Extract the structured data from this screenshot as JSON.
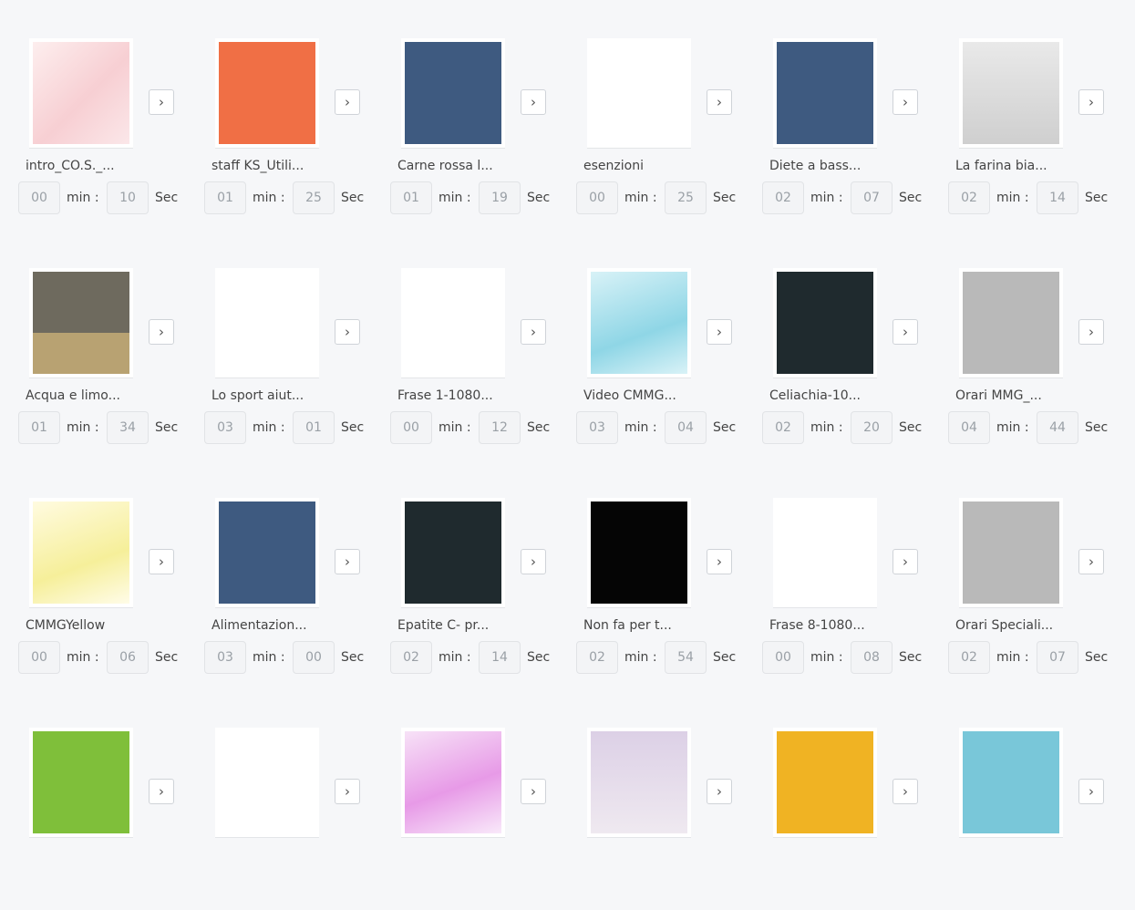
{
  "labels": {
    "min": "min :",
    "sec": "Sec",
    "arrow": "›"
  },
  "items": [
    {
      "title": "intro_CO.S._...",
      "min": "00",
      "sec": "10",
      "art": "pinkfade"
    },
    {
      "title": "staff KS_Utili...",
      "min": "01",
      "sec": "25",
      "art": "orange"
    },
    {
      "title": "Carne rossa l...",
      "min": "01",
      "sec": "19",
      "art": "navy"
    },
    {
      "title": "esenzioni",
      "min": "00",
      "sec": "25",
      "art": "white"
    },
    {
      "title": "Diete a bass...",
      "min": "02",
      "sec": "07",
      "art": "navy"
    },
    {
      "title": "La farina bia...",
      "min": "02",
      "sec": "14",
      "art": "kitchen"
    },
    {
      "title": "Acqua e limo...",
      "min": "01",
      "sec": "34",
      "art": "room"
    },
    {
      "title": "Lo sport aiut...",
      "min": "03",
      "sec": "01",
      "art": "white"
    },
    {
      "title": "Frase 1-1080...",
      "min": "00",
      "sec": "12",
      "art": "white"
    },
    {
      "title": "Video CMMG...",
      "min": "03",
      "sec": "04",
      "art": "cyan"
    },
    {
      "title": "Celiachia-10...",
      "min": "02",
      "sec": "20",
      "art": "dark"
    },
    {
      "title": "Orari MMG_...",
      "min": "04",
      "sec": "44",
      "art": "gray"
    },
    {
      "title": "CMMGYellow",
      "min": "00",
      "sec": "06",
      "art": "yellow"
    },
    {
      "title": "Alimentazion...",
      "min": "03",
      "sec": "00",
      "art": "navy"
    },
    {
      "title": "Epatite C- pr...",
      "min": "02",
      "sec": "14",
      "art": "dark"
    },
    {
      "title": "Non fa per t...",
      "min": "02",
      "sec": "54",
      "art": "black"
    },
    {
      "title": "Frase 8-1080...",
      "min": "00",
      "sec": "08",
      "art": "white"
    },
    {
      "title": "Orari Speciali...",
      "min": "02",
      "sec": "07",
      "art": "gray"
    },
    {
      "title": "",
      "min": "",
      "sec": "",
      "art": "green"
    },
    {
      "title": "",
      "min": "",
      "sec": "",
      "art": "white"
    },
    {
      "title": "",
      "min": "",
      "sec": "",
      "art": "violet"
    },
    {
      "title": "",
      "min": "",
      "sec": "",
      "art": "lilac"
    },
    {
      "title": "",
      "min": "",
      "sec": "",
      "art": "gold"
    },
    {
      "title": "",
      "min": "",
      "sec": "",
      "art": "sky"
    }
  ]
}
